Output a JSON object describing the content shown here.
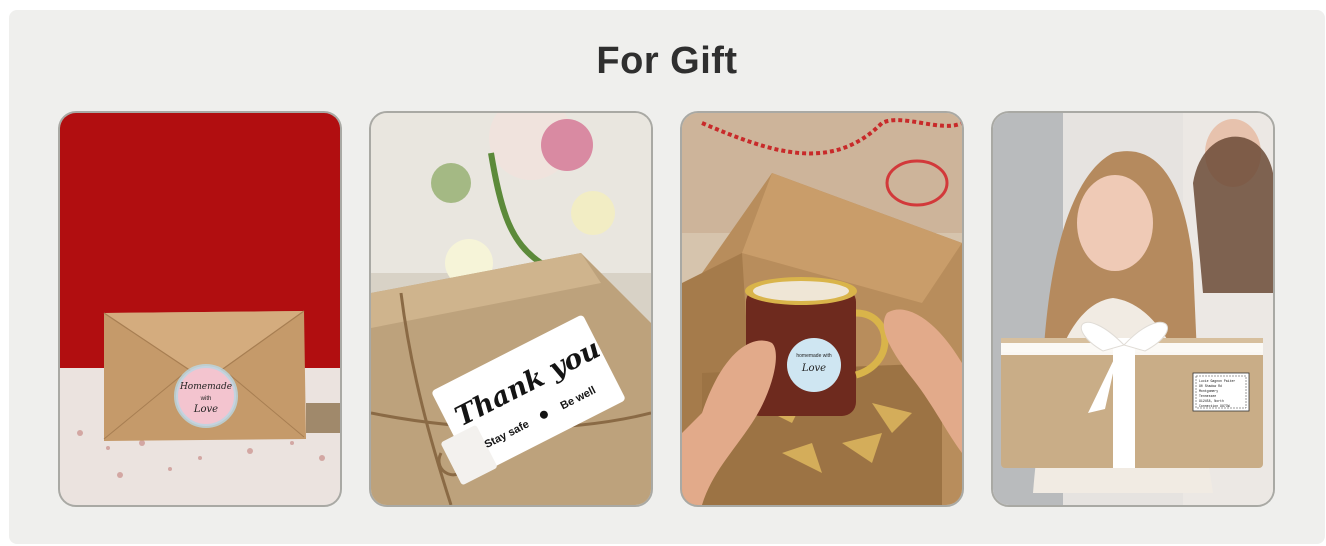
{
  "section": {
    "title": "For Gift"
  },
  "cards": [
    {
      "name": "envelope",
      "sticker": {
        "line1": "Homemade",
        "line2": "with",
        "line3": "Love"
      }
    },
    {
      "name": "thank-you",
      "tag": {
        "line1": "Thank you",
        "line2": "Stay safe",
        "line3": "Be well"
      }
    },
    {
      "name": "mug",
      "sticker": {
        "line1": "homemade with",
        "line2": "Love"
      }
    },
    {
      "name": "parcel",
      "label": {
        "line1": "Lucie Gagnon Paiter",
        "line2": "90 Shadow Rd",
        "line3": "Montgomery",
        "line4": "Tennessee",
        "line5": "912458, North",
        "line6": "Connection 9873W"
      }
    }
  ],
  "colors": {
    "panel": "#efefed",
    "title": "#2f2f2f",
    "card_border": "#a9a9a4",
    "kraft": "#c9a77b"
  }
}
